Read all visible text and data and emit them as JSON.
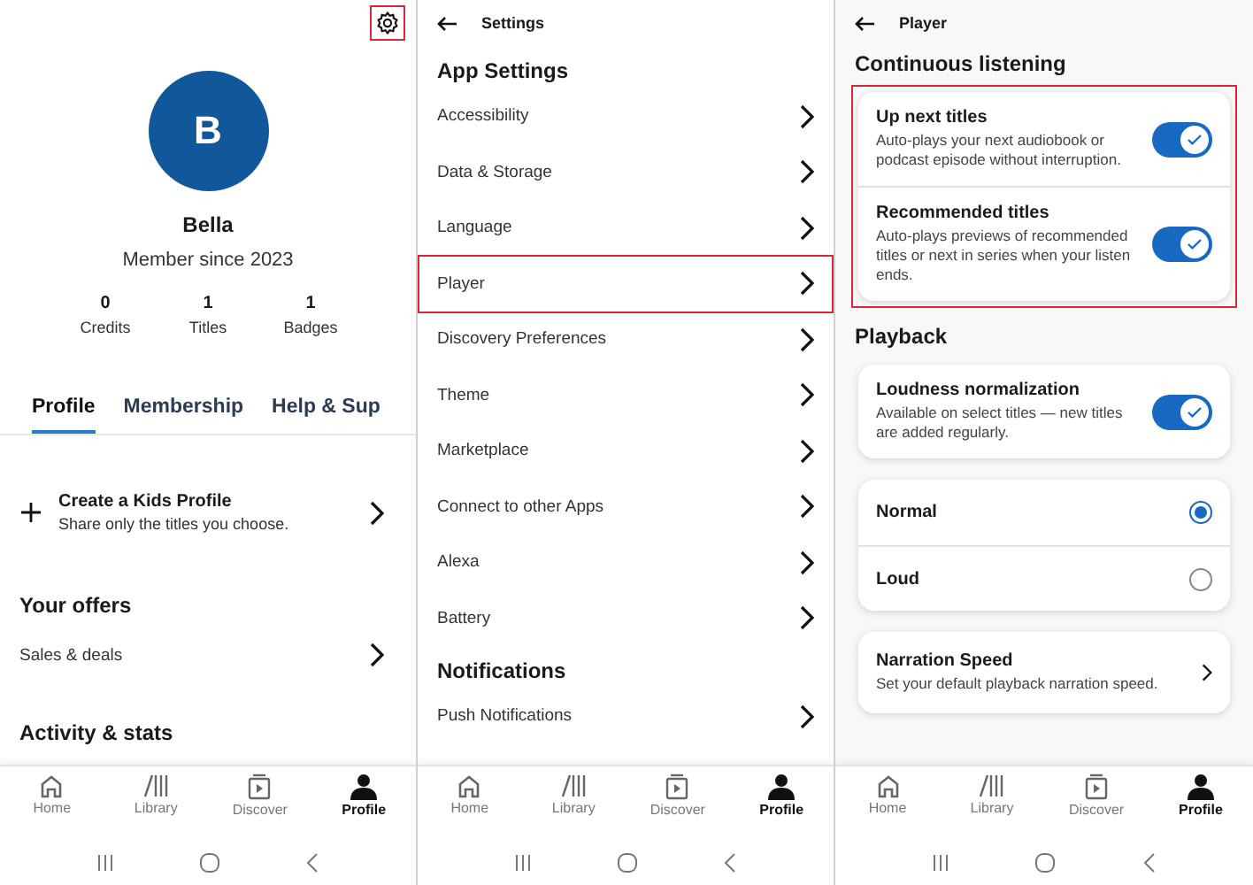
{
  "profile_screen": {
    "settings_highlighted": true,
    "avatar_letter": "B",
    "name": "Bella",
    "member_since": "Member since 2023",
    "stats": [
      {
        "value": "0",
        "label": "Credits"
      },
      {
        "value": "1",
        "label": "Titles"
      },
      {
        "value": "1",
        "label": "Badges"
      }
    ],
    "tabs": [
      {
        "label": "Profile",
        "selected": true
      },
      {
        "label": "Membership",
        "selected": false
      },
      {
        "label": "Help & Sup",
        "selected": false
      }
    ],
    "kids_profile": {
      "title": "Create a Kids Profile",
      "subtitle": "Share only the titles you choose."
    },
    "offers_heading": "Your offers",
    "offers": [
      "Sales & deals"
    ],
    "activity_heading": "Activity & stats",
    "nav": [
      {
        "kind": "home",
        "label": "Home",
        "selected": false
      },
      {
        "kind": "library",
        "label": "Library",
        "selected": false
      },
      {
        "kind": "discover",
        "label": "Discover",
        "selected": false
      },
      {
        "kind": "profile",
        "label": "Profile",
        "selected": true
      }
    ]
  },
  "settings_screen": {
    "title": "Settings",
    "sections": [
      {
        "heading": "App Settings",
        "items": [
          {
            "label": "Accessibility",
            "highlighted": false
          },
          {
            "label": "Data & Storage",
            "highlighted": false
          },
          {
            "label": "Language",
            "highlighted": false
          },
          {
            "label": "Player",
            "highlighted": true
          },
          {
            "label": "Discovery Preferences",
            "highlighted": false
          },
          {
            "label": "Theme",
            "highlighted": false
          },
          {
            "label": "Marketplace",
            "highlighted": false
          },
          {
            "label": "Connect to other Apps",
            "highlighted": false
          },
          {
            "label": "Alexa",
            "highlighted": false
          },
          {
            "label": "Battery",
            "highlighted": false
          }
        ]
      },
      {
        "heading": "Notifications",
        "items": [
          {
            "label": "Push Notifications",
            "highlighted": false
          }
        ]
      }
    ],
    "nav": [
      {
        "kind": "home",
        "label": "Home",
        "selected": false
      },
      {
        "kind": "library",
        "label": "Library",
        "selected": false
      },
      {
        "kind": "discover",
        "label": "Discover",
        "selected": false
      },
      {
        "kind": "profile",
        "label": "Profile",
        "selected": true
      }
    ]
  },
  "player_screen": {
    "title": "Player",
    "sections": [
      {
        "heading": "Continuous listening",
        "cards": [
          {
            "kind": "toggles",
            "highlighted": true,
            "rows": [
              {
                "title": "Up next titles",
                "description": "Auto-plays your next audiobook or podcast episode without interruption.",
                "on": true
              },
              {
                "title": "Recommended titles",
                "description": "Auto-plays previews of recommended titles or next in series when your listen ends.",
                "on": true
              }
            ]
          }
        ]
      },
      {
        "heading": "Playback",
        "cards": [
          {
            "kind": "toggles",
            "highlighted": false,
            "rows": [
              {
                "title": "Loudness normalization",
                "description": "Available on select titles — new titles are added regularly.",
                "on": true
              }
            ]
          },
          {
            "kind": "radios",
            "highlighted": false,
            "options": [
              {
                "label": "Normal",
                "selected": true
              },
              {
                "label": "Loud",
                "selected": false
              }
            ]
          },
          {
            "kind": "link",
            "highlighted": false,
            "title": "Narration Speed",
            "description": "Set your default playback narration speed."
          }
        ]
      }
    ],
    "nav": [
      {
        "kind": "home",
        "label": "Home",
        "selected": false
      },
      {
        "kind": "library",
        "label": "Library",
        "selected": false
      },
      {
        "kind": "discover",
        "label": "Discover",
        "selected": false
      },
      {
        "kind": "profile",
        "label": "Profile",
        "selected": true
      }
    ]
  }
}
